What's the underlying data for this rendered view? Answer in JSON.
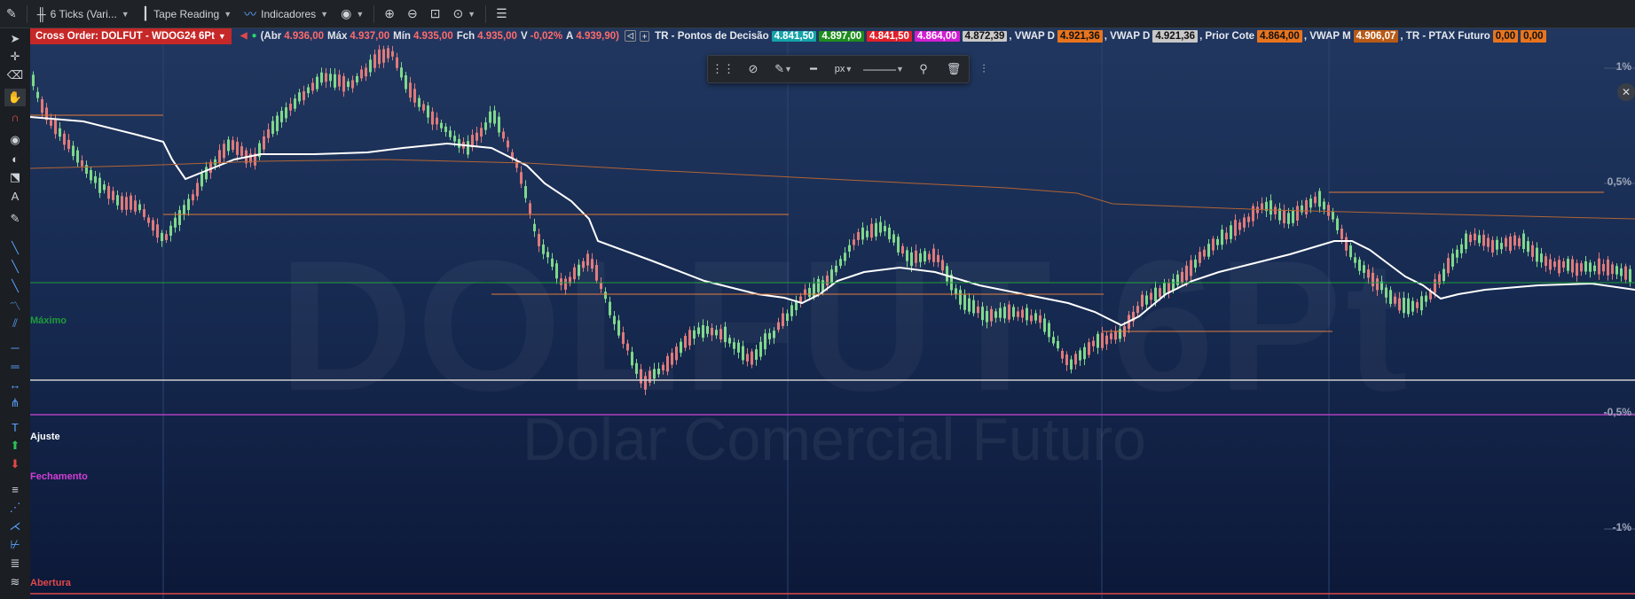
{
  "toolbar": {
    "ticks_label": "6 Ticks (Vari...",
    "tape_label": "Tape Reading",
    "indicators_label": "Indicadores"
  },
  "info": {
    "order_tag": "Cross Order: DOLFUT - WDOG24 6Pt",
    "abr_k": "(Abr",
    "abr_v": "4.936,00",
    "max_k": "Máx",
    "max_v": "4.937,00",
    "min_k": "Mín",
    "min_v": "4.935,00",
    "fch_k": "Fch",
    "fch_v": "4.935,00",
    "var_k": "V",
    "var_v": "-0,02%",
    "a_k": "A",
    "a_v": "4.939,90)",
    "tr_label": "TR - Pontos de Decisão",
    "badges": [
      {
        "text": "4.841,50",
        "bg": "#14a3a8",
        "fg": "#ffffff"
      },
      {
        "text": "4.897,00",
        "bg": "#1e8c1e",
        "fg": "#ffffff"
      },
      {
        "text": "4.841,50",
        "bg": "#e0202a",
        "fg": "#ffffff"
      },
      {
        "text": "4.864,00",
        "bg": "#d21ed2",
        "fg": "#ffffff"
      },
      {
        "text": "4.872,39",
        "bg": "#c8c8c8",
        "fg": "#111111"
      }
    ],
    "vwap_d1_label": ", VWAP D",
    "vwap_d1_value": "4.921,36",
    "vwap_d2_label": ", VWAP D",
    "vwap_d2_value": "4.921,36",
    "prior_label": ", Prior Cote",
    "prior_value": "4.864,00",
    "vwap_m_label": ", VWAP M",
    "vwap_m_value": "4.906,07",
    "ptax_label": ", TR - PTAX Futuro",
    "ptax_v1": "0,00",
    "ptax_v2": "0,00"
  },
  "floatbar": {
    "px_label": "px"
  },
  "levels": {
    "maximo": "Máximo",
    "ajuste": "Ajuste",
    "fechamento": "Fechamento",
    "abertura": "Abertura"
  },
  "axis": {
    "p1": "1%",
    "p05": "0,5%",
    "m05": "-0,5%",
    "m1": "-1%"
  },
  "watermark": {
    "symbol": "DOLFUT 6Pt",
    "name": "Dolar Comercial Futuro"
  },
  "colors": {
    "up": "#7fd88a",
    "down": "#e07a7a",
    "vwap": "#ffffff",
    "orange": "#e27a3a",
    "maximo": "#1f9d3a",
    "ajuste": "#d0d0d0",
    "fechamento": "#b03fc0",
    "abertura": "#e04848"
  }
}
